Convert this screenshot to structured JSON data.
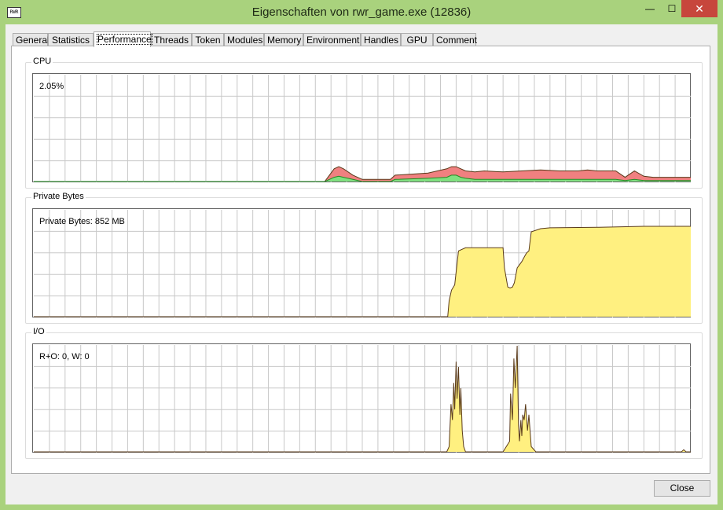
{
  "window": {
    "title": "Eigenschaften von rwr_game.exe (12836)",
    "icon_text": "RWR",
    "min_glyph": "—",
    "max_glyph": "☐",
    "close_glyph": "✕"
  },
  "tabs": [
    {
      "label": "General",
      "active": false
    },
    {
      "label": "Statistics",
      "active": false
    },
    {
      "label": "Performance",
      "active": true
    },
    {
      "label": "Threads",
      "active": false
    },
    {
      "label": "Token",
      "active": false
    },
    {
      "label": "Modules",
      "active": false
    },
    {
      "label": "Memory",
      "active": false
    },
    {
      "label": "Environment",
      "active": false
    },
    {
      "label": "Handles",
      "active": false
    },
    {
      "label": "GPU",
      "active": false
    },
    {
      "label": "Comment",
      "active": false
    }
  ],
  "groups": {
    "cpu": {
      "label": "CPU",
      "value_text": "2.05%"
    },
    "private_bytes": {
      "label": "Private Bytes",
      "value_text": "Private Bytes: 852 MB"
    },
    "io": {
      "label": "I/O",
      "value_text": "R+O: 0, W: 0"
    }
  },
  "buttons": {
    "close_label": "Close"
  },
  "colors": {
    "titlebar": "#a9d27d",
    "grid": "#c8c8c8",
    "cpu_total_fill": "#f08080",
    "cpu_kernel_fill": "#80e080",
    "memory_fill": "#fff080",
    "io_fill": "#fff080",
    "line_dark": "#5a3a1a",
    "baseline_green": "#228b22"
  },
  "chart_data": [
    {
      "type": "area",
      "name": "cpu",
      "ylim": [
        0,
        100
      ],
      "x": [
        0,
        54,
        62,
        63,
        64,
        65,
        66,
        68,
        70,
        72,
        74,
        76,
        77,
        84,
        88,
        89,
        90,
        91,
        92,
        94,
        96,
        100,
        104,
        108,
        112,
        116,
        118,
        120,
        124,
        126,
        128,
        130,
        132,
        134,
        136,
        140
      ],
      "y": [
        0,
        0,
        0,
        6,
        12,
        14,
        12,
        6,
        2,
        2,
        2,
        2,
        6,
        8,
        12,
        14,
        14,
        12,
        10,
        9,
        10,
        9,
        10,
        11,
        10,
        10,
        11,
        10,
        10,
        4,
        10,
        5,
        4,
        4,
        4,
        4
      ],
      "kernel_y": [
        0,
        0,
        0,
        2,
        4,
        5,
        4,
        2,
        0,
        0,
        0,
        0,
        2,
        3,
        4,
        6,
        6,
        4,
        3,
        2,
        2,
        2,
        2,
        2,
        2,
        2,
        2,
        2,
        2,
        1,
        2,
        1,
        1,
        1,
        1,
        1
      ]
    },
    {
      "type": "area",
      "name": "private_bytes",
      "ylim": [
        0,
        1000
      ],
      "x": [
        0,
        88.2,
        88.5,
        89,
        89.7,
        90,
        90.5,
        92,
        94,
        95,
        100,
        100.3,
        101,
        101.5,
        102,
        102.4,
        103,
        104,
        104.6,
        105,
        105.5,
        106,
        108,
        110,
        120,
        130,
        140
      ],
      "y": [
        0,
        0,
        150,
        250,
        300,
        420,
        620,
        650,
        650,
        650,
        650,
        460,
        280,
        270,
        280,
        320,
        460,
        520,
        570,
        600,
        620,
        800,
        830,
        838,
        842,
        852,
        852
      ]
    },
    {
      "type": "area",
      "name": "io",
      "ylim": [
        0,
        100
      ],
      "x": [
        0,
        88,
        88.5,
        88.9,
        89.2,
        89.5,
        89.7,
        90,
        90.2,
        90.5,
        90.8,
        91,
        91.3,
        91.6,
        92,
        100,
        101.4,
        101.6,
        102,
        102.3,
        102.6,
        103,
        103.3,
        103.5,
        103.8,
        104,
        104.2,
        104.5,
        104.8,
        105.2,
        105.5,
        106,
        107,
        138,
        138.5,
        139,
        140
      ],
      "y": [
        0,
        0,
        5,
        45,
        30,
        65,
        40,
        85,
        50,
        80,
        35,
        60,
        20,
        5,
        0,
        0,
        10,
        55,
        30,
        88,
        60,
        100,
        25,
        10,
        30,
        15,
        35,
        30,
        45,
        20,
        35,
        5,
        0,
        0,
        2,
        0,
        0
      ]
    }
  ]
}
